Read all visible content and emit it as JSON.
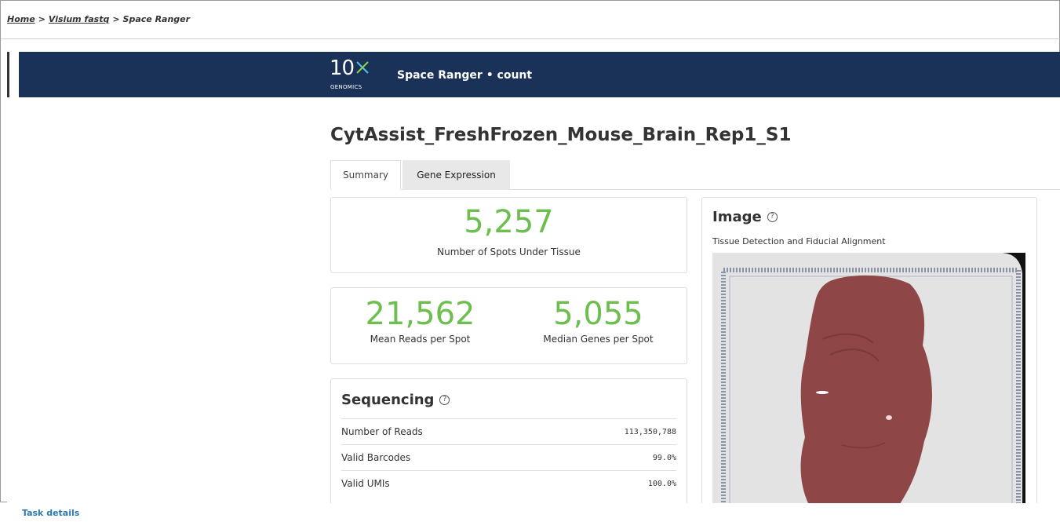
{
  "breadcrumb": {
    "home": "Home",
    "sep1": ">",
    "visium": "Visium fastq",
    "sep2": ">",
    "current": "Space Ranger"
  },
  "topbar": {
    "logo_number": "10",
    "logo_company": "GENOMICS",
    "title": "Space Ranger • count"
  },
  "sample": {
    "title": "CytAssist_FreshFrozen_Mouse_Brain_Rep1_S1"
  },
  "tabs": [
    {
      "label": "Summary"
    },
    {
      "label": "Gene Expression"
    }
  ],
  "metrics": {
    "spots_under_tissue": {
      "value": "5,257",
      "label": "Number of Spots Under Tissue"
    },
    "mean_reads": {
      "value": "21,562",
      "label": "Mean Reads per Spot"
    },
    "median_genes": {
      "value": "5,055",
      "label": "Median Genes per Spot"
    }
  },
  "sequencing": {
    "title": "Sequencing",
    "help": "?",
    "rows": [
      {
        "label": "Number of Reads",
        "value": "113,350,788"
      },
      {
        "label": "Valid Barcodes",
        "value": "99.0%"
      },
      {
        "label": "Valid UMIs",
        "value": "100.0%"
      }
    ]
  },
  "image": {
    "title": "Image",
    "help": "?",
    "subtitle": "Tissue Detection and Fiducial Alignment"
  },
  "footer": {
    "task_details": "Task details"
  },
  "colors": {
    "topbar": "#1a3258",
    "metric_green": "#6cbf4e",
    "tissue": "#8e4646",
    "link": "#2a7ab0"
  }
}
